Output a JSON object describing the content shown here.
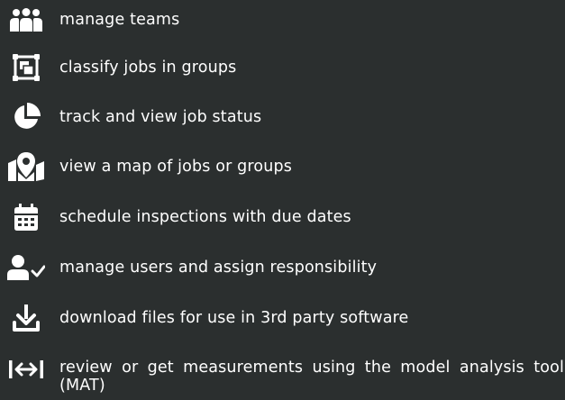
{
  "features": [
    {
      "icon": "users-group-icon",
      "text": "manage teams"
    },
    {
      "icon": "group-squares-icon",
      "text": "classify jobs in groups"
    },
    {
      "icon": "pie-chart-icon",
      "text": "track and view job status"
    },
    {
      "icon": "map-marker-icon",
      "text": "view a map of jobs or groups"
    },
    {
      "icon": "calendar-icon",
      "text": "schedule inspections with due dates"
    },
    {
      "icon": "user-check-icon",
      "text": "manage users and assign responsibility"
    },
    {
      "icon": "download-icon",
      "text": "download files for use in 3rd party software"
    },
    {
      "icon": "measure-arrows-icon",
      "text": "review or get measurements using the model analysis tool (MAT)"
    }
  ],
  "colors": {
    "background": "#2b2f2f",
    "foreground": "#ffffff"
  }
}
